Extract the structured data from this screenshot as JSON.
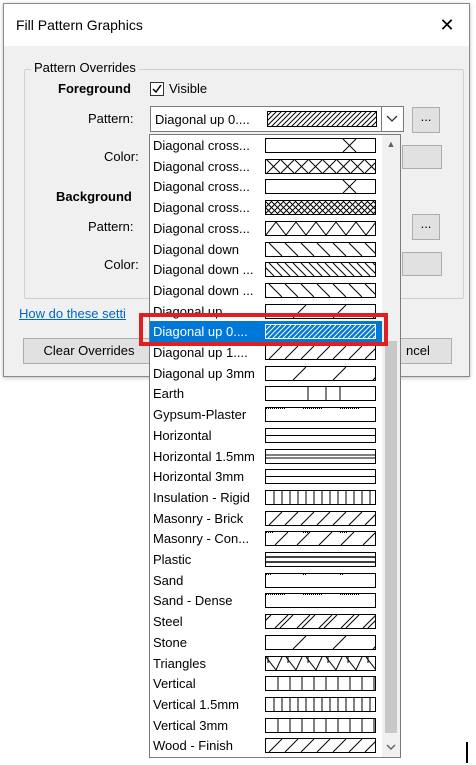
{
  "dialog": {
    "title": "Fill Pattern Graphics",
    "close_glyph": "✕",
    "group_label": "Pattern Overrides",
    "foreground": {
      "heading": "Foreground",
      "visible_label": "Visible",
      "visible_checked": true,
      "pattern_label": "Pattern:",
      "pattern_value": "Diagonal up 0....",
      "color_label": "Color:"
    },
    "background": {
      "heading": "Background",
      "pattern_label": "Pattern:",
      "color_label": "Color:"
    },
    "ellipsis": "...",
    "help_link": "How do these setti",
    "clear_button": "Clear Overrides",
    "cancel_button": "ncel"
  },
  "dropdown": {
    "selected_index": 9,
    "items": [
      {
        "label": "Diagonal cross...",
        "pattern": "cross-sparse"
      },
      {
        "label": "Diagonal cross...",
        "pattern": "cross-medium"
      },
      {
        "label": "Diagonal cross...",
        "pattern": "cross-sparse"
      },
      {
        "label": "Diagonal cross...",
        "pattern": "cross-dense"
      },
      {
        "label": "Diagonal cross...",
        "pattern": "zigzag"
      },
      {
        "label": "Diagonal down",
        "pattern": "diag-down"
      },
      {
        "label": "Diagonal down ...",
        "pattern": "diag-down-dense"
      },
      {
        "label": "Diagonal down ...",
        "pattern": "diag-down"
      },
      {
        "label": "Diagonal up",
        "pattern": "diag-up-sparse"
      },
      {
        "label": "Diagonal up 0....",
        "pattern": "diag-up-dense"
      },
      {
        "label": "Diagonal up 1....",
        "pattern": "diag-up"
      },
      {
        "label": "Diagonal up 3mm",
        "pattern": "diag-up-sparse"
      },
      {
        "label": "Earth",
        "pattern": "earth"
      },
      {
        "label": "Gypsum-Plaster",
        "pattern": "dots-dense"
      },
      {
        "label": "Horizontal",
        "pattern": "horizontal"
      },
      {
        "label": "Horizontal 1.5mm",
        "pattern": "horizontal-dense"
      },
      {
        "label": "Horizontal 3mm",
        "pattern": "horizontal"
      },
      {
        "label": "Insulation - Rigid",
        "pattern": "vertical-dense"
      },
      {
        "label": "Masonry - Brick",
        "pattern": "diag-up"
      },
      {
        "label": "Masonry - Con...",
        "pattern": "diag-up-dots"
      },
      {
        "label": "Plastic",
        "pattern": "plastic"
      },
      {
        "label": "Sand",
        "pattern": "dots-sparse"
      },
      {
        "label": "Sand - Dense",
        "pattern": "dots-dense"
      },
      {
        "label": "Steel",
        "pattern": "diag-up-pairs"
      },
      {
        "label": "Stone",
        "pattern": "diag-up-sparse"
      },
      {
        "label": "Triangles",
        "pattern": "triangles"
      },
      {
        "label": "Vertical",
        "pattern": "vertical"
      },
      {
        "label": "Vertical 1.5mm",
        "pattern": "vertical-dense"
      },
      {
        "label": "Vertical 3mm",
        "pattern": "vertical"
      },
      {
        "label": "Wood - Finish",
        "pattern": "diag-up"
      }
    ]
  },
  "colors": {
    "selection": "#0078d7",
    "highlight_box": "#e02020",
    "link": "#0066cc"
  }
}
